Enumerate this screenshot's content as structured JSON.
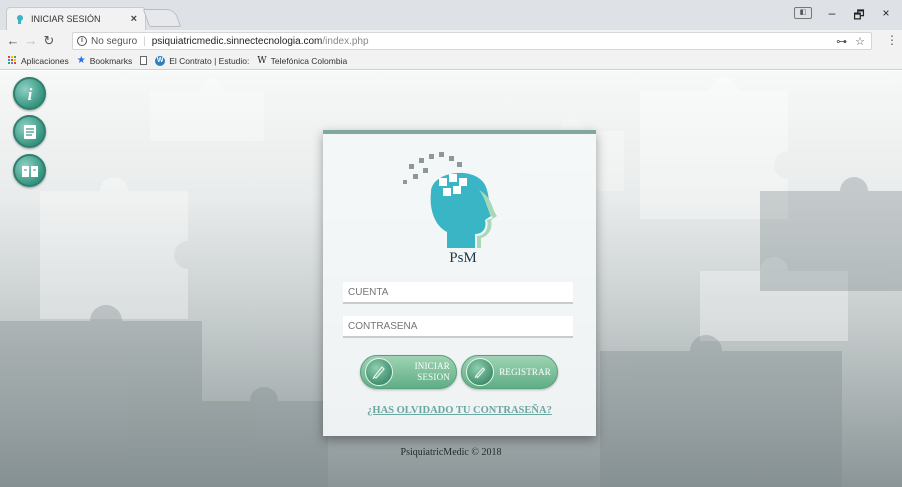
{
  "browser": {
    "tab_title": "INICIAR SESIÓN",
    "tab_close": "×",
    "security_label": "No seguro",
    "url_host": "psiquiatricmedic.sinnectecnologia.com",
    "url_path": "/index.php",
    "window_controls": {
      "minimize": "–",
      "maximize": "🗗",
      "close": "×"
    },
    "bookmarks": [
      {
        "label": "Aplicaciones",
        "icon": "apps-icon"
      },
      {
        "label": "Bookmarks",
        "icon": "star-icon"
      },
      {
        "label": "",
        "icon": "page-icon"
      },
      {
        "label": "El Contrato | Estudio:",
        "icon": "wordpress-icon"
      },
      {
        "label": "Telefónica Colombia",
        "icon": "w-icon"
      }
    ]
  },
  "sidebar": {
    "items": [
      {
        "name": "info",
        "icon": "info-icon"
      },
      {
        "name": "notes",
        "icon": "document-icon"
      },
      {
        "name": "book",
        "icon": "book-icon"
      }
    ]
  },
  "login": {
    "logo_text": "PsM",
    "username_placeholder": "CUENTA",
    "password_placeholder": "CONTRASEÑA",
    "login_label_line1": "INICIAR",
    "login_label_line2": "SESION",
    "register_label": "REGISTRAR",
    "forgot_password": "¿HAS OLVIDADO TU CONTRASEÑA?"
  },
  "footer": {
    "copyright": "PsiquiatricMedic © 2018"
  },
  "colors": {
    "accent": "#5fae85",
    "brand_teal": "#3ab5c5",
    "link": "#6aa7a0"
  }
}
